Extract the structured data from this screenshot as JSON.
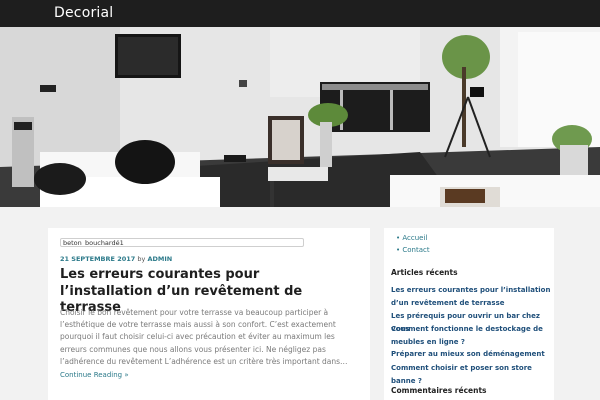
{
  "header": {
    "site_title": "Decorial"
  },
  "hero": {
    "image_alt": ""
  },
  "post": {
    "tag_field": "beton_bouchardé1",
    "date": "21 SEPTEMBRE 2017",
    "by": "by",
    "author": "ADMIN",
    "title": "Les erreurs courantes pour l’installation d’un revêtement de terrasse",
    "excerpt": "Choisir le bon revêtement pour votre terrasse va beaucoup participer à l’esthétique de votre terrasse mais aussi à son confort. C’est exactement pourquoi il faut choisir celui-ci avec précaution et éviter au maximum les erreurs communes que nous allons vous présenter ici. Ne négligez pas l’adhérence du revêtement L’adhérence est un critère très important dans…",
    "continue_label": "Continue Reading »"
  },
  "sidebar": {
    "pages": [
      "Accueil",
      "Contact"
    ],
    "recent_heading": "Articles récents",
    "recent_posts": [
      "Les erreurs courantes pour l’installation d’un revêtement de terrasse",
      "Les prérequis pour ouvrir un bar chez vous",
      "Comment fonctionne le destockage de meubles en ligne ?",
      "Préparer au mieux son déménagement",
      "Comment choisir et poser son store banne ?"
    ],
    "comments_heading": "Commentaires récents"
  }
}
